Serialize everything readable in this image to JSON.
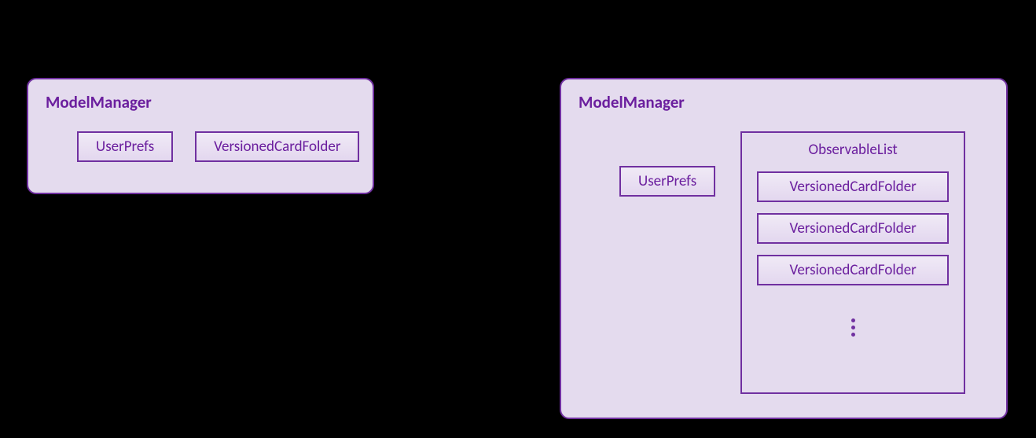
{
  "left": {
    "title": "ModelManager",
    "userprefs": "UserPrefs",
    "vcard": "VersionedCardFolder"
  },
  "right": {
    "title": "ModelManager",
    "userprefs": "UserPrefs",
    "observable_title": "ObservableList",
    "vcards": [
      "VersionedCardFolder",
      "VersionedCardFolder",
      "VersionedCardFolder"
    ]
  }
}
